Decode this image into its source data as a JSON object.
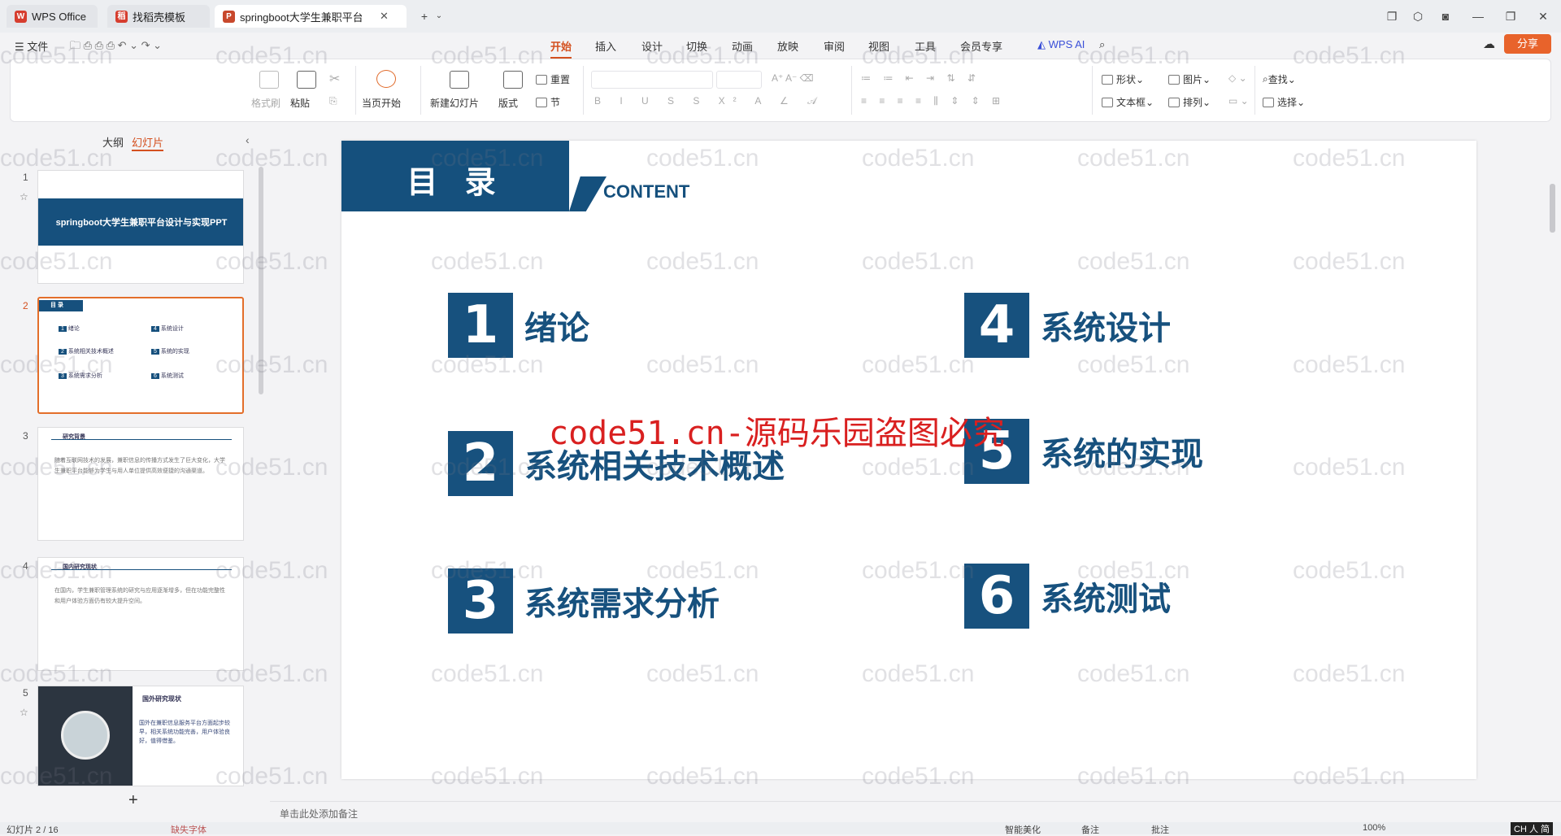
{
  "tabs": [
    {
      "label": "WPS Office"
    },
    {
      "label": "找稻壳模板"
    },
    {
      "label": "springboot大学生兼职平台"
    }
  ],
  "menu": {
    "file": "文件",
    "items": [
      "开始",
      "插入",
      "设计",
      "切换",
      "动画",
      "放映",
      "审阅",
      "视图",
      "工具",
      "会员专享"
    ],
    "ai": "WPS AI",
    "share": "分享"
  },
  "ribbon": {
    "format_painter": "格式刷",
    "paste": "粘贴",
    "play_from_current": "当页开始",
    "new_slide": "新建幻灯片",
    "layout": "版式",
    "section": "节",
    "reset": "重置",
    "shape": "形状",
    "picture": "图片",
    "find": "查找",
    "textbox": "文本框",
    "arrange": "排列",
    "select": "选择"
  },
  "panel": {
    "outline": "大纲",
    "slides": "幻灯片",
    "add": "+"
  },
  "thumbs": [
    {
      "num": "1",
      "title": "springboot大学生兼职平台设计与实现PPT"
    },
    {
      "num": "2",
      "title": "目 录",
      "items": [
        "绪论",
        "系统相关技术概述",
        "系统需求分析",
        "系统设计",
        "系统的实现",
        "系统测试"
      ]
    },
    {
      "num": "3",
      "title": "研究背景",
      "body": "随着互联网技术的发展，兼职信息的传播方式发生了巨大变化，大学生兼职平台能够为学生与用人单位提供高效便捷的沟通渠道。"
    },
    {
      "num": "4",
      "title": "国内研究现状",
      "body": "在国内，学生兼职管理系统的研究与应用逐渐增多，但在功能完整性和用户体验方面仍有较大提升空间。"
    },
    {
      "num": "5",
      "title": "国外研究现状",
      "body": "国外在兼职信息服务平台方面起步较早，相关系统功能完善，用户体验良好，值得借鉴。"
    }
  ],
  "slide": {
    "title": "目  录",
    "subtitle": "CONTENT",
    "items": [
      {
        "n": "1",
        "label": "绪论"
      },
      {
        "n": "2",
        "label": "系统相关技术概述"
      },
      {
        "n": "3",
        "label": "系统需求分析"
      },
      {
        "n": "4",
        "label": "系统设计"
      },
      {
        "n": "5",
        "label": "系统的实现"
      },
      {
        "n": "6",
        "label": "系统测试"
      }
    ]
  },
  "watermark": {
    "text": "code51.cn",
    "red": "code51.cn-源码乐园盗图必究"
  },
  "notes_placeholder": "单击此处添加备注",
  "status": {
    "slide": "幻灯片 2 / 16",
    "font": "缺失字体",
    "smart": "智能美化",
    "notes": "备注",
    "comment": "批注",
    "zoom": "100%",
    "lang": "CH 人 简"
  }
}
